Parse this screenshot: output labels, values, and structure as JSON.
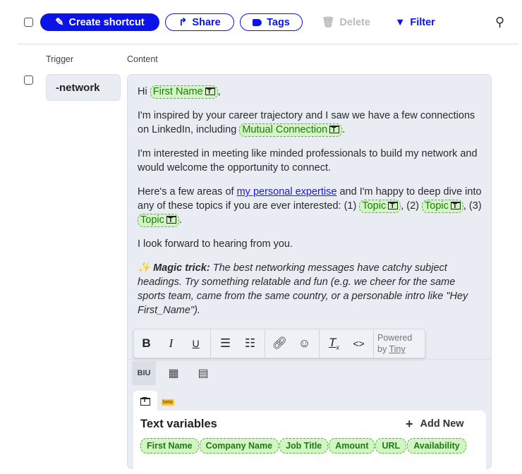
{
  "toolbar": {
    "create": "Create shortcut",
    "share": "Share",
    "tags": "Tags",
    "delete": "Delete",
    "filter": "Filter"
  },
  "table": {
    "trigger_header": "Trigger",
    "content_header": "Content"
  },
  "row": {
    "trigger": "-network",
    "p1": {
      "text": "Hi",
      "var": "First Name",
      "end": ","
    },
    "p2": {
      "text": "I'm inspired by your career trajectory and I saw we have a few connections on LinkedIn, including",
      "var": "Mutual Connection",
      "end": "."
    },
    "p3": "I'm interested in meeting like minded professionals to build my network and would welcome the opportunity to connect.",
    "p4": {
      "a": "Here's a few areas of",
      "link": "my personal expertise",
      "b": "and I'm happy to deep dive into any of these topics if you are ever interested: (1)",
      "var1": "Topic",
      "c": ", (2)",
      "var2": "Topic",
      "d": ", (3)",
      "var3": "Topic",
      "end": "."
    },
    "p5": "I look forward to hearing from you.",
    "p6": {
      "emoji": "✨",
      "bold": "Magic trick:",
      "text": "The best networking messages have catchy subject headings. Try something relatable and fun (e.g. we cheer for the same sports team, came from the same country, or a personable intro like \"Hey First_Name\")."
    }
  },
  "editor": {
    "powered": "Powered",
    "by": "by",
    "tiny": "Tiny",
    "biu": "BIU",
    "beta": "beta"
  },
  "variables": {
    "title": "Text variables",
    "add_new": "Add New",
    "items": [
      "First Name",
      "Company Name",
      "Job Title",
      "Amount",
      "URL",
      "Availability"
    ]
  },
  "colors": {
    "accent": "#0a14e8",
    "chip_bg": "#d3f5c3",
    "chip_text": "#1d7a12"
  }
}
